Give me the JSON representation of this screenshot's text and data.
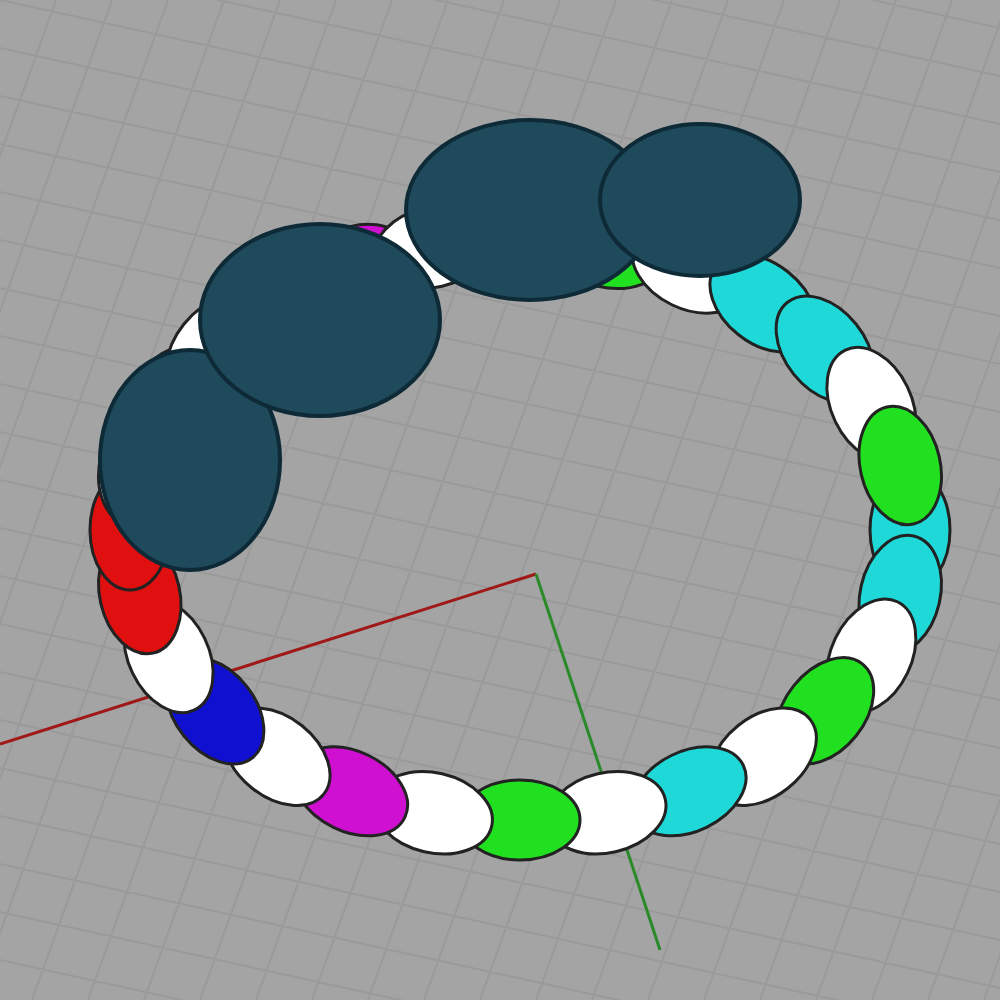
{
  "viewport": {
    "kind": "perspective"
  }
}
